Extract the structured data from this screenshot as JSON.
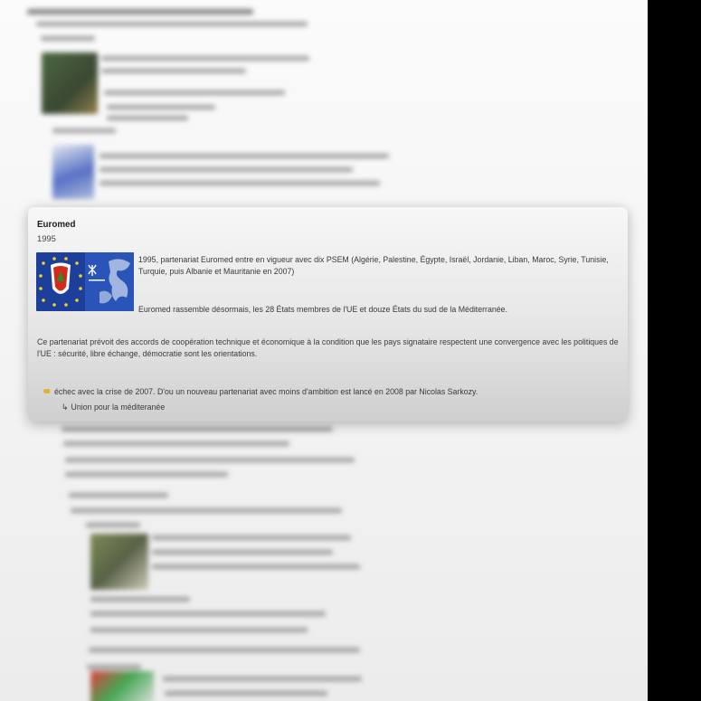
{
  "card": {
    "title": "Euromed",
    "year": "1995",
    "paragraph1": "1995, partenariat Euromed entre en vigueur avec dix  PSEM (Algérie, Palestine, Égypte, Israël, Jordanie, Liban, Maroc, Syrie, Tunisie, Turquie, puis Albanie et Mauritanie en 2007)",
    "paragraph2": "Euromed rassemble désormais, les 28 États membres de l'UE et douze États du sud de la Méditerranée.",
    "paragraph3": "Ce partenariat prévoit des accords de coopération technique et économique à la condition que les pays signataire respectent une convergence avec les politiques de l'UE : sécurité, libre échange, démocratie sont les orientations.",
    "bullet": "échec avec la crise de 2007. D'ou un nouveau partenariat avec moins d'ambition est lancé en 2008 par Nicolas Sarkozy.",
    "sub_arrow": "↳",
    "sub_item": "Union pour la méditeranée"
  },
  "icons": {
    "bullet": "pencil-bullet-icon",
    "flag": "euromed-flag-image"
  },
  "colors": {
    "flag_blue": "#1c3f9c",
    "flag_star": "#f4d21f",
    "bullet": "#e2b12f"
  }
}
